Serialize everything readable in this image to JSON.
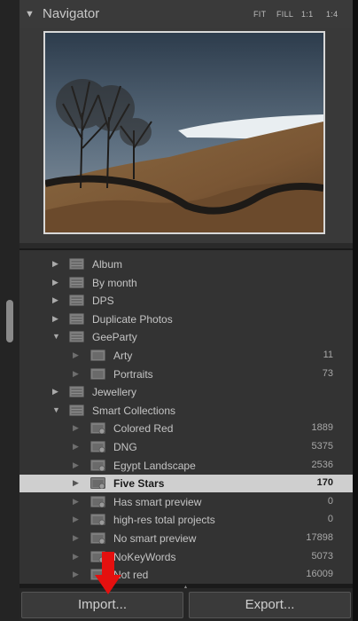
{
  "navigator": {
    "title": "Navigator",
    "zoom_options": [
      "FIT",
      "FILL",
      "1:1",
      "1:4"
    ]
  },
  "collections": [
    {
      "label": "Album",
      "type": "set",
      "arrow": "right",
      "count": ""
    },
    {
      "label": "By month",
      "type": "set",
      "arrow": "right",
      "count": ""
    },
    {
      "label": "DPS",
      "type": "set",
      "arrow": "right",
      "count": ""
    },
    {
      "label": "Duplicate Photos",
      "type": "set",
      "arrow": "right",
      "count": ""
    },
    {
      "label": "GeeParty",
      "type": "set",
      "arrow": "down",
      "count": ""
    },
    {
      "label": "Arty",
      "type": "folder",
      "arrow": "none",
      "count": "11"
    },
    {
      "label": "Portraits",
      "type": "folder",
      "arrow": "none",
      "count": "73"
    },
    {
      "label": "Jewellery",
      "type": "set",
      "arrow": "right",
      "count": ""
    },
    {
      "label": "Smart Collections",
      "type": "set",
      "arrow": "down",
      "count": ""
    },
    {
      "label": "Colored Red",
      "type": "smart",
      "arrow": "none",
      "count": "1889"
    },
    {
      "label": "DNG",
      "type": "smart",
      "arrow": "none",
      "count": "5375"
    },
    {
      "label": "Egypt Landscape",
      "type": "smart",
      "arrow": "none",
      "count": "2536"
    },
    {
      "label": "Five Stars",
      "type": "smart",
      "arrow": "none",
      "count": "170",
      "selected": true
    },
    {
      "label": "Has smart preview",
      "type": "smart",
      "arrow": "none",
      "count": "0"
    },
    {
      "label": "high-res total projects",
      "type": "smart",
      "arrow": "none",
      "count": "0"
    },
    {
      "label": "No smart preview",
      "type": "smart",
      "arrow": "none",
      "count": "17898"
    },
    {
      "label": "NoKeyWords",
      "type": "smart",
      "arrow": "none",
      "count": "5073"
    },
    {
      "label": "Not red",
      "type": "smart",
      "arrow": "none",
      "count": "16009"
    }
  ],
  "buttons": {
    "import_label": "Import...",
    "export_label": "Export..."
  },
  "colors": {
    "selected_row": "#cfcfcf",
    "annotation_arrow": "#e4100f"
  }
}
